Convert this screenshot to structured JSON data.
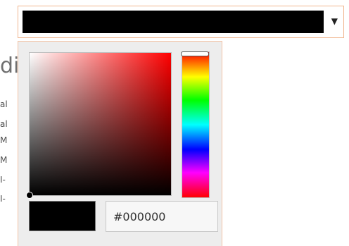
{
  "background": {
    "heading_fragment": "di",
    "lines": [
      "al",
      "al",
      "M",
      "M",
      "I-",
      "I-"
    ]
  },
  "select": {
    "selected_color": "#000000",
    "arrow_icon": "▼"
  },
  "picker": {
    "hue_top": "#ff0000",
    "hex_value": "#000000",
    "preview_color": "#000000"
  }
}
